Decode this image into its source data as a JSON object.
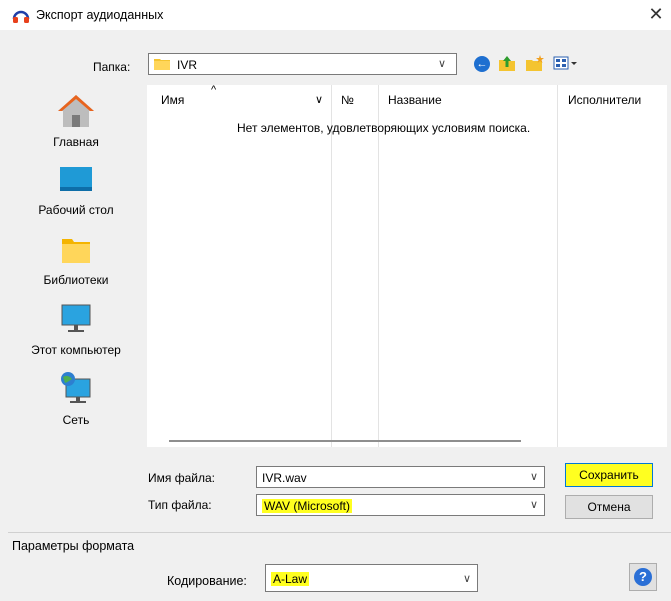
{
  "window": {
    "title": "Экспорт аудиоданных",
    "close_glyph": "✕",
    "icon": "audacity-headphones-icon"
  },
  "folder": {
    "label": "Папка:",
    "value": "IVR",
    "arrow": "∨",
    "nav_icons": [
      "back-icon",
      "up-folder-icon",
      "new-folder-icon",
      "view-menu-icon"
    ]
  },
  "places": [
    {
      "id": "home",
      "label": "Главная",
      "icon": "home-icon"
    },
    {
      "id": "desktop",
      "label": "Рабочий стол",
      "icon": "desktop-icon"
    },
    {
      "id": "libraries",
      "label": "Библиотеки",
      "icon": "libraries-icon"
    },
    {
      "id": "computer",
      "label": "Этот компьютер",
      "icon": "computer-icon"
    },
    {
      "id": "network",
      "label": "Сеть",
      "icon": "network-icon"
    }
  ],
  "filelist": {
    "columns": [
      "Имя",
      "№",
      "Название",
      "Исполнители"
    ],
    "sort_indicator": "^",
    "column_menu": "∨",
    "empty_message": "Нет элементов, удовлетворяющих условиям поиска."
  },
  "filename": {
    "label": "Имя файла:",
    "value": "IVR.wav",
    "arrow": "∨"
  },
  "filetype": {
    "label": "Тип файла:",
    "value": "WAV (Microsoft)",
    "arrow": "∨"
  },
  "buttons": {
    "save": "Сохранить",
    "cancel": "Отмена"
  },
  "format_options": {
    "title": "Параметры формата",
    "encoding_label": "Кодирование:",
    "encoding_value": "A-Law",
    "arrow": "∨",
    "help": "?"
  },
  "colors": {
    "highlight": "#ffff20",
    "accent": "#0078d7",
    "folder": "#f4c430"
  }
}
